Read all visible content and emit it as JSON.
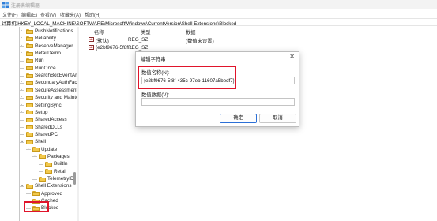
{
  "window": {
    "title": "注册表编辑器"
  },
  "menu": [
    "文件(F)",
    "编辑(E)",
    "查看(V)",
    "收藏夹(A)",
    "帮助(H)"
  ],
  "address": "计算机\\HKEY_LOCAL_MACHINE\\SOFTWARE\\Microsoft\\Windows\\CurrentVersion\\Shell Extensions\\Blocked",
  "tree": [
    {
      "label": "PushNotifications",
      "depth": 0,
      "expander": "›"
    },
    {
      "label": "Reliability",
      "depth": 0,
      "expander": "›"
    },
    {
      "label": "ReserveManager",
      "depth": 0,
      "expander": "›"
    },
    {
      "label": "RetailDemo",
      "depth": 0,
      "expander": "›"
    },
    {
      "label": "Run",
      "depth": 0,
      "expander": ""
    },
    {
      "label": "RunOnce",
      "depth": 0,
      "expander": ""
    },
    {
      "label": "SearchBoxEventArg",
      "depth": 0,
      "expander": ""
    },
    {
      "label": "SecondaryAuthFacto",
      "depth": 0,
      "expander": "›"
    },
    {
      "label": "SecureAssessment",
      "depth": 0,
      "expander": "›"
    },
    {
      "label": "Security and Mainte",
      "depth": 0,
      "expander": "›"
    },
    {
      "label": "SettingSync",
      "depth": 0,
      "expander": "›"
    },
    {
      "label": "Setup",
      "depth": 0,
      "expander": "›"
    },
    {
      "label": "SharedAccess",
      "depth": 0,
      "expander": ""
    },
    {
      "label": "SharedDLLs",
      "depth": 0,
      "expander": ""
    },
    {
      "label": "SharedPC",
      "depth": 0,
      "expander": ""
    },
    {
      "label": "Shell",
      "depth": 0,
      "expander": "⌄"
    },
    {
      "label": "Update",
      "depth": 1,
      "expander": "⌄"
    },
    {
      "label": "Packages",
      "depth": 2,
      "expander": "⌄"
    },
    {
      "label": "BuiltIn",
      "depth": 3,
      "expander": ""
    },
    {
      "label": "Retail",
      "depth": 3,
      "expander": ""
    },
    {
      "label": "TelemetryID",
      "depth": 2,
      "expander": ""
    },
    {
      "label": "Shell Extensions",
      "depth": 0,
      "expander": "⌄"
    },
    {
      "label": "Approved",
      "depth": 1,
      "expander": ""
    },
    {
      "label": "Cached",
      "depth": 1,
      "expander": ""
    },
    {
      "label": "Blocked",
      "depth": 1,
      "expander": "",
      "selected": true
    }
  ],
  "list": {
    "headers": {
      "name": "名称",
      "type": "类型",
      "data": "数据"
    },
    "rows": [
      {
        "icon": "ab",
        "name": "(默认)",
        "type": "REG_SZ",
        "data": "(数值未设置)"
      },
      {
        "icon": "ab",
        "name": "{e2bf9676-5f8f...",
        "type": "REG_SZ",
        "data": ""
      }
    ]
  },
  "dialog": {
    "title": "编辑字符串",
    "close": "✕",
    "name_label": "数值名称(N):",
    "name_value": "{e2bf9676-5f8f-435c-97eb-11607a5bedf7}",
    "data_label": "数值数据(V):",
    "data_value": "",
    "ok": "确定",
    "cancel": "取消"
  },
  "colors": {
    "highlight": "#e0142b",
    "focus": "#2b6fd6",
    "folder": "#f2c94c"
  }
}
